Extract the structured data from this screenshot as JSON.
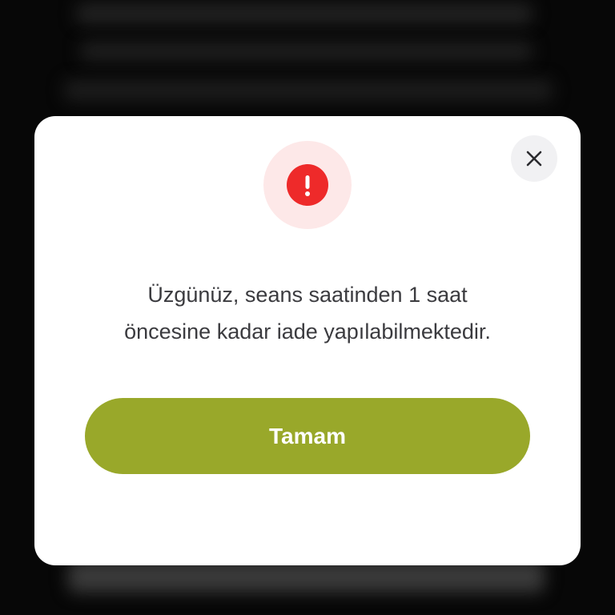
{
  "dialog": {
    "icon": "exclamation-icon",
    "message_line1": "Üzgünüz, seans saatinden 1 saat",
    "message_line2": "öncesine kadar iade yapılabilmektedir.",
    "confirm_label": "Tamam",
    "close_icon": "close-icon"
  },
  "colors": {
    "accent": "#99a82a",
    "alert_red": "#ee2a2a",
    "alert_halo": "#fde8e8",
    "text": "#3b3b3f",
    "close_bg": "#f1f1f3"
  }
}
